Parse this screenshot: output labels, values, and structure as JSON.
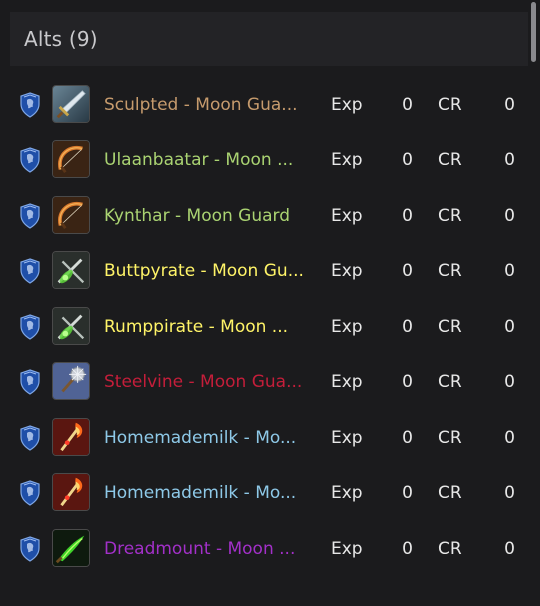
{
  "panel": {
    "title": "Alts (9)"
  },
  "alts": [
    {
      "name": "Sculpted - Moon Guard",
      "display": "Sculpted - Moon Gua...",
      "class_color": "#c69b6d",
      "icon": "sword-icon",
      "exp_label": "Exp",
      "exp": "0",
      "cr_label": "CR",
      "cr": "0"
    },
    {
      "name": "Ulaanbaatar - Moon Guard",
      "display": "Ulaanbaatar - Moon ...",
      "class_color": "#aad372",
      "icon": "bow-icon",
      "exp_label": "Exp",
      "exp": "0",
      "cr_label": "CR",
      "cr": "0"
    },
    {
      "name": "Kynthar - Moon Guard",
      "display": "Kynthar - Moon Guard",
      "class_color": "#aad372",
      "icon": "bow-icon",
      "exp_label": "Exp",
      "exp": "0",
      "cr_label": "CR",
      "cr": "0"
    },
    {
      "name": "Buttpyrate - Moon Guard",
      "display": "Buttpyrate - Moon Gu...",
      "class_color": "#fff468",
      "icon": "daggers-icon",
      "exp_label": "Exp",
      "exp": "0",
      "cr_label": "CR",
      "cr": "0"
    },
    {
      "name": "Rumppirate - Moon Guard",
      "display": "Rumppirate - Moon ...",
      "class_color": "#fff468",
      "icon": "daggers-icon",
      "exp_label": "Exp",
      "exp": "0",
      "cr_label": "CR",
      "cr": "0"
    },
    {
      "name": "Steelvine - Moon Guard",
      "display": "Steelvine - Moon Gua...",
      "class_color": "#c41e3a",
      "icon": "mace-icon",
      "exp_label": "Exp",
      "exp": "0",
      "cr_label": "CR",
      "cr": "0"
    },
    {
      "name": "Homemademilk - Moon Guard",
      "display": "Homemademilk - Mo...",
      "class_color": "#8ec9e8",
      "icon": "fire-staff-icon",
      "exp_label": "Exp",
      "exp": "0",
      "cr_label": "CR",
      "cr": "0"
    },
    {
      "name": "Homemademilk - Moon Guard",
      "display": "Homemademilk - Mo...",
      "class_color": "#8ec9e8",
      "icon": "fire-staff-icon",
      "exp_label": "Exp",
      "exp": "0",
      "cr_label": "CR",
      "cr": "0"
    },
    {
      "name": "Dreadmount - Moon Guard",
      "display": "Dreadmount - Moon ...",
      "class_color": "#a330c9",
      "icon": "fel-blade-icon",
      "exp_label": "Exp",
      "exp": "0",
      "cr_label": "CR",
      "cr": "0"
    }
  ],
  "colors": {
    "background": "#1b1b1d",
    "header": "#232326",
    "faction": "#1f4fa8"
  }
}
